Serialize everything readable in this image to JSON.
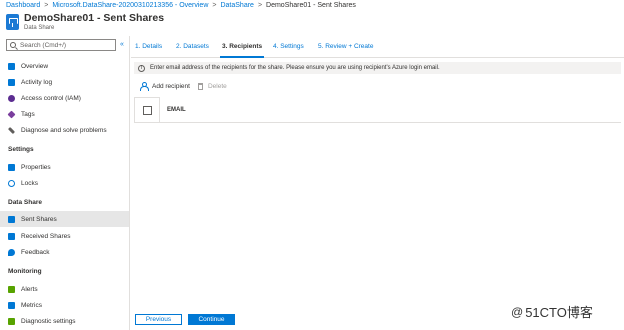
{
  "breadcrumb": {
    "items": [
      "Dashboard",
      "Microsoft.DataShare-20200310213356 - Overview",
      "DataShare",
      "DemoShare01 - Sent Shares"
    ]
  },
  "header": {
    "title": "DemoShare01 - Sent Shares",
    "subtitle": "Data Share"
  },
  "sidebar": {
    "search_placeholder": "Search (Cmd+/)",
    "collapse_glyph": "«",
    "items": [
      {
        "label": "Overview",
        "icon": "overview-icon",
        "color": "#0078d4"
      },
      {
        "label": "Activity log",
        "icon": "activity-log-icon",
        "color": "#0078d4"
      },
      {
        "label": "Access control (IAM)",
        "icon": "access-control-icon",
        "color": "#5c2d91"
      },
      {
        "label": "Tags",
        "icon": "tag-icon",
        "color": "#7a3e9d"
      },
      {
        "label": "Diagnose and solve problems",
        "icon": "wrench-icon",
        "color": "#605e5c"
      }
    ],
    "section_settings": "Settings",
    "settings_items": [
      {
        "label": "Properties",
        "icon": "properties-icon",
        "color": "#0078d4"
      },
      {
        "label": "Locks",
        "icon": "lock-icon",
        "color": "#0078d4"
      }
    ],
    "section_datashare": "Data Share",
    "datashare_items": [
      {
        "label": "Sent Shares",
        "icon": "sent-shares-icon",
        "color": "#0078d4"
      },
      {
        "label": "Received Shares",
        "icon": "received-shares-icon",
        "color": "#0078d4"
      },
      {
        "label": "Feedback",
        "icon": "feedback-icon",
        "color": "#0078d4"
      }
    ],
    "section_monitoring": "Monitoring",
    "monitoring_items": [
      {
        "label": "Alerts",
        "icon": "alert-icon",
        "color": "#57a300"
      },
      {
        "label": "Metrics",
        "icon": "metrics-icon",
        "color": "#0078d4"
      },
      {
        "label": "Diagnostic settings",
        "icon": "diagnostic-settings-icon",
        "color": "#57a300"
      }
    ]
  },
  "tabs": [
    {
      "label": "1. Details"
    },
    {
      "label": "2. Datasets"
    },
    {
      "label": "3. Recipients"
    },
    {
      "label": "4. Settings"
    },
    {
      "label": "5. Review + Create"
    }
  ],
  "info_text": "Enter email address of the recipients for the share. Please ensure you are using recipient's Azure login email.",
  "toolbar": {
    "add_label": "Add recipient",
    "delete_label": "Delete"
  },
  "table": {
    "column_email": "EMAIL"
  },
  "footer": {
    "previous_label": "Previous",
    "continue_label": "Continue"
  },
  "watermark": {
    "text": "51CTO博客",
    "at": "@"
  },
  "colors": {
    "accent": "#0078d4",
    "active_nav_bg": "#e6e6e6"
  }
}
